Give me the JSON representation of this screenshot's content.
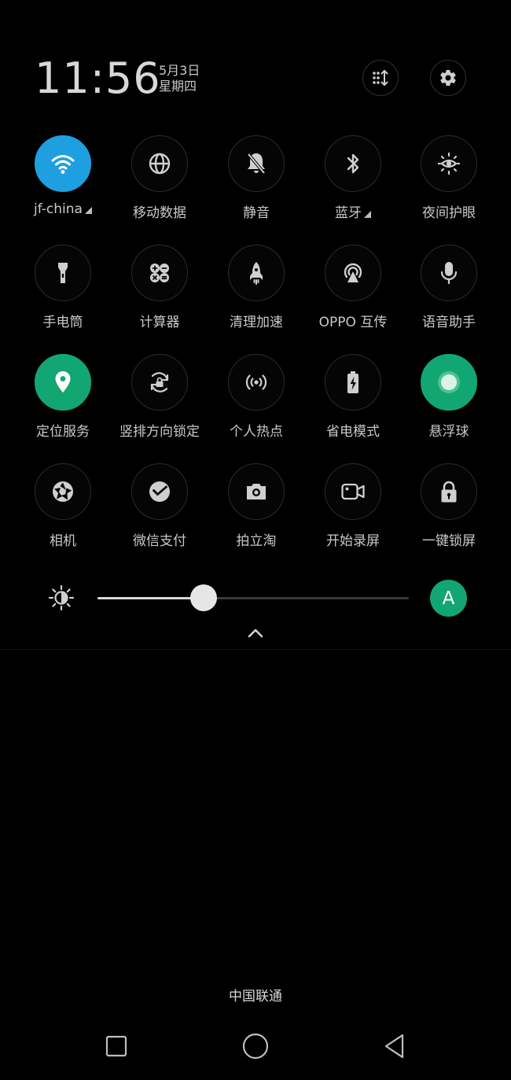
{
  "status": {
    "time": "11:56",
    "date": "5月3日",
    "weekday": "星期四"
  },
  "header_buttons": [
    {
      "icon": "edit-tiles-icon"
    },
    {
      "icon": "gear-icon"
    }
  ],
  "tiles": [
    {
      "label": "jf-china",
      "icon": "wifi-icon",
      "active": "blue",
      "expand": true
    },
    {
      "label": "移动数据",
      "icon": "globe-icon",
      "active": "",
      "expand": false
    },
    {
      "label": "静音",
      "icon": "bell-off-icon",
      "active": "",
      "expand": false
    },
    {
      "label": "蓝牙",
      "icon": "bluetooth-icon",
      "active": "",
      "expand": true
    },
    {
      "label": "夜间护眼",
      "icon": "eye-sun-icon",
      "active": "",
      "expand": false
    },
    {
      "label": "手电筒",
      "icon": "flashlight-icon",
      "active": "",
      "expand": false
    },
    {
      "label": "计算器",
      "icon": "calculator-icon",
      "active": "",
      "expand": false
    },
    {
      "label": "清理加速",
      "icon": "rocket-icon",
      "active": "",
      "expand": false
    },
    {
      "label": "OPPO 互传",
      "icon": "share-signal-icon",
      "active": "",
      "expand": false
    },
    {
      "label": "语音助手",
      "icon": "microphone-icon",
      "active": "",
      "expand": false
    },
    {
      "label": "定位服务",
      "icon": "location-pin-icon",
      "active": "green",
      "expand": false
    },
    {
      "label": "竖排方向锁定",
      "icon": "rotation-lock-icon",
      "active": "",
      "expand": false
    },
    {
      "label": "个人热点",
      "icon": "hotspot-icon",
      "active": "",
      "expand": false
    },
    {
      "label": "省电模式",
      "icon": "battery-saver-icon",
      "active": "",
      "expand": false
    },
    {
      "label": "悬浮球",
      "icon": "floating-ball-icon",
      "active": "green",
      "expand": false
    },
    {
      "label": "相机",
      "icon": "camera-shutter-icon",
      "active": "",
      "expand": false
    },
    {
      "label": "微信支付",
      "icon": "wechat-pay-icon",
      "active": "",
      "expand": false
    },
    {
      "label": "拍立淘",
      "icon": "photo-camera-icon",
      "active": "",
      "expand": false
    },
    {
      "label": "开始录屏",
      "icon": "video-record-icon",
      "active": "",
      "expand": false
    },
    {
      "label": "一键锁屏",
      "icon": "lock-icon",
      "active": "",
      "expand": false
    }
  ],
  "brightness": {
    "level": 0.34,
    "auto_label": "A",
    "icon": "brightness-icon"
  },
  "carrier": "中国联通",
  "colors": {
    "accent_blue": "#1e9fe0",
    "accent_green": "#12a673",
    "background": "#000000"
  }
}
